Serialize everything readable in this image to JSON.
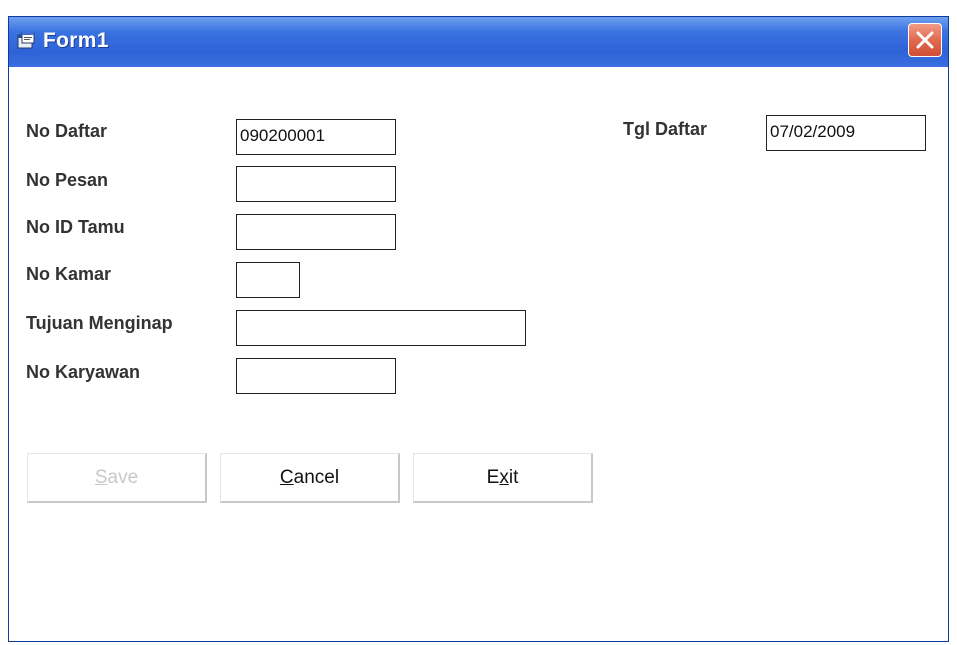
{
  "window": {
    "title": "Form1"
  },
  "form": {
    "no_daftar": {
      "label": "No Daftar",
      "value": "090200001"
    },
    "no_pesan": {
      "label": "No Pesan",
      "value": ""
    },
    "no_id_tamu": {
      "label": "No ID Tamu",
      "value": ""
    },
    "no_kamar": {
      "label": "No Kamar",
      "value": ""
    },
    "tujuan_menginap": {
      "label": "Tujuan Menginap",
      "value": ""
    },
    "no_karyawan": {
      "label": "No Karyawan",
      "value": ""
    },
    "tgl_daftar": {
      "label": "Tgl Daftar",
      "value": "07/02/2009"
    }
  },
  "buttons": {
    "save": {
      "pre": "",
      "ul": "S",
      "post": "ave",
      "enabled": false
    },
    "cancel": {
      "pre": "",
      "ul": "C",
      "post": "ancel",
      "enabled": true
    },
    "exit": {
      "pre": "E",
      "ul": "x",
      "post": "it",
      "enabled": true
    }
  },
  "colors": {
    "titlebar": "#2e62d6",
    "close": "#e06a4e",
    "disabled_text": "#c8c8c8"
  },
  "icons": {
    "title": "form-window-icon",
    "close": "close-icon"
  }
}
